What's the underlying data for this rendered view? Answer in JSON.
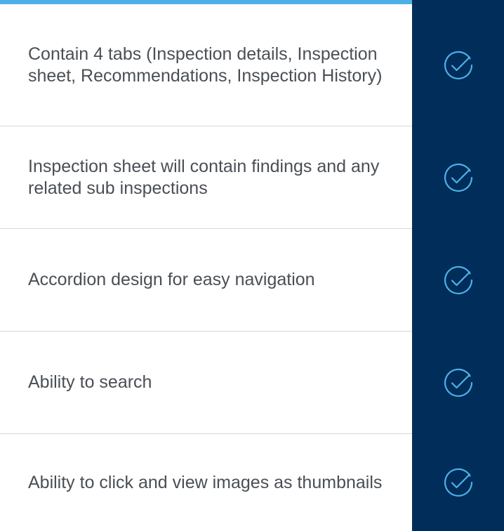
{
  "features": [
    {
      "text": "Contain 4 tabs (Inspection details, Inspection sheet, Recommendations, Inspection History)",
      "icon": "check-circle-icon"
    },
    {
      "text": "Inspection sheet will contain findings and any related sub inspections",
      "icon": "check-circle-icon"
    },
    {
      "text": "Accordion design for easy navigation",
      "icon": "check-circle-icon"
    },
    {
      "text": "Ability to search",
      "icon": "check-circle-icon"
    },
    {
      "text": "Ability to click and view images as thumbnails",
      "icon": "check-circle-icon"
    }
  ],
  "colors": {
    "accent": "#4db1e8",
    "panel": "#012d5a",
    "text": "#4a4f55",
    "divider": "#d5d8db",
    "icon_stroke": "#4db1e8"
  }
}
